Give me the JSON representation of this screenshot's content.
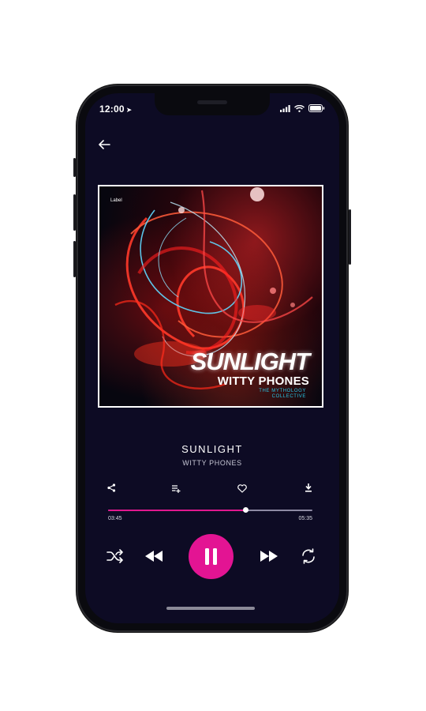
{
  "status_bar": {
    "time": "12:00"
  },
  "album": {
    "label": "Label",
    "cover_title": "SUNLIGHT",
    "cover_artist": "WITTY PHONES",
    "cover_subtitle": "THE MYTHOLOGY COLLECTIVE"
  },
  "track": {
    "title": "SUNLIGHT",
    "artist": "WITTY PHONES"
  },
  "playback": {
    "elapsed": "03:45",
    "duration": "05:35",
    "progress_fraction": 0.67,
    "state": "playing"
  },
  "icons": {
    "back": "arrow-left-icon",
    "share": "share-icon",
    "add_to_playlist": "playlist-add-icon",
    "favorite": "heart-icon",
    "download": "download-icon",
    "shuffle": "shuffle-icon",
    "previous": "rewind-icon",
    "pause": "pause-icon",
    "next": "fast-forward-icon",
    "repeat": "repeat-icon"
  },
  "colors": {
    "accent": "#e31493",
    "background": "#0d0b24",
    "cover_subtitle": "#27c6e6"
  }
}
